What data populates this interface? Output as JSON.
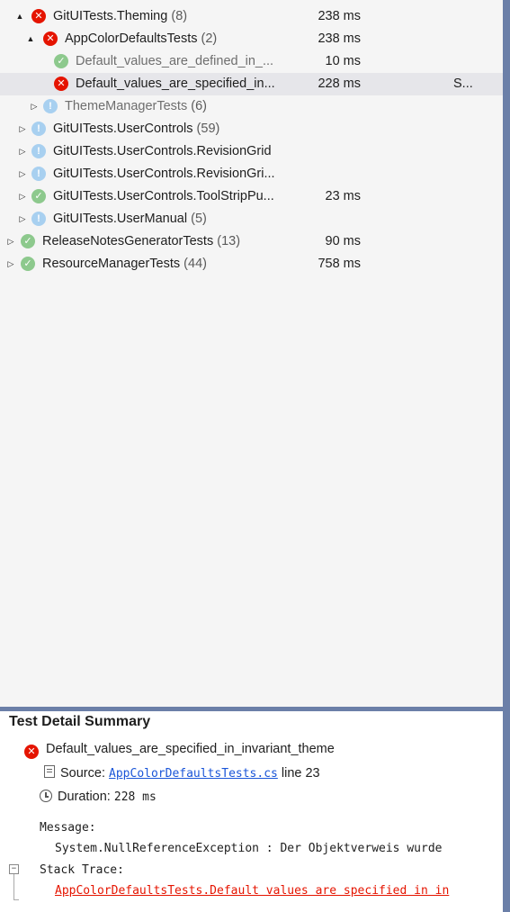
{
  "tree": {
    "rows": [
      {
        "name": "GitUITests.Theming",
        "count": "(8)",
        "duration": "238 ms",
        "status": "failed",
        "expander": "▲",
        "expanded": true
      },
      {
        "name": "AppColorDefaultsTests",
        "count": "(2)",
        "duration": "238 ms",
        "status": "failed",
        "expander": "▲",
        "expanded": true
      },
      {
        "name": "Default_values_are_defined_in_...",
        "count": "",
        "duration": "10 ms",
        "status": "passed",
        "expander": "",
        "dim": true
      },
      {
        "name": "Default_values_are_specified_in...",
        "count": "",
        "duration": "228 ms",
        "status": "failed",
        "expander": "",
        "selected": true,
        "extra": "S..."
      },
      {
        "name": "ThemeManagerTests",
        "count": "(6)",
        "duration": "",
        "status": "notrun",
        "expander": "▷",
        "dim": true
      },
      {
        "name": "GitUITests.UserControls",
        "count": "(59)",
        "duration": "",
        "status": "notrun",
        "expander": "▷"
      },
      {
        "name": "GitUITests.UserControls.RevisionGrid",
        "count": "",
        "duration": "",
        "status": "notrun",
        "expander": "▷"
      },
      {
        "name": "GitUITests.UserControls.RevisionGri...",
        "count": "",
        "duration": "",
        "status": "notrun",
        "expander": "▷"
      },
      {
        "name": "GitUITests.UserControls.ToolStripPu...",
        "count": "",
        "duration": "23 ms",
        "status": "passed",
        "expander": "▷"
      },
      {
        "name": "GitUITests.UserManual",
        "count": "(5)",
        "duration": "",
        "status": "notrun",
        "expander": "▷"
      },
      {
        "name": "ReleaseNotesGeneratorTests",
        "count": "(13)",
        "duration": "90 ms",
        "status": "passed",
        "expander": "▷"
      },
      {
        "name": "ResourceManagerTests",
        "count": "(44)",
        "duration": "758 ms",
        "status": "passed",
        "expander": "▷"
      }
    ]
  },
  "detail": {
    "title": "Test Detail Summary",
    "test_name": "Default_values_are_specified_in_invariant_theme",
    "source_label": "Source:",
    "source_file": "AppColorDefaultsTests.cs",
    "source_line": "line 23",
    "duration_label": "Duration:",
    "duration_value": "228 ms",
    "message_label": "Message:",
    "message_text": "System.NullReferenceException : Der Objektverweis wurde",
    "stack_label": "Stack Trace:",
    "stack_text": "AppColorDefaultsTests.Default values are specified in in",
    "collapse_glyph": "−"
  },
  "colors": {
    "failed": "#e51400",
    "passed": "#8dc98d",
    "notrun": "#a8d0f0",
    "accent": "#6b7fa8",
    "link": "#1a55d8"
  },
  "icons": {
    "failed": "x-circle-icon",
    "passed": "check-circle-icon",
    "notrun": "info-circle-icon",
    "source": "document-icon",
    "duration": "clock-icon"
  }
}
